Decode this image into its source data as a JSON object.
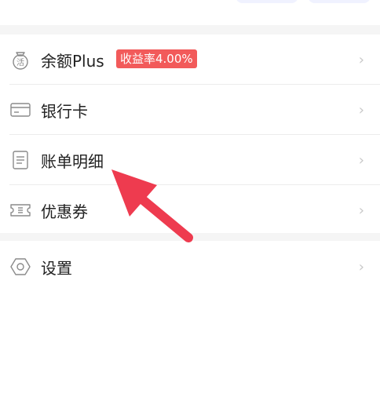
{
  "menu": {
    "items": [
      {
        "label": "余额Plus",
        "badge": "收益率4.00%",
        "icon": "huo-coin-icon"
      },
      {
        "label": "银行卡",
        "icon": "bank-card-icon"
      },
      {
        "label": "账单明细",
        "icon": "bill-icon"
      },
      {
        "label": "优惠券",
        "icon": "coupon-icon"
      }
    ],
    "settings": {
      "label": "设置",
      "icon": "settings-hex-icon"
    }
  },
  "annotation": {
    "arrow_color": "#ee3b4f"
  },
  "colors": {
    "badge": "#f25a5a",
    "icon_stroke": "#8a8a8a",
    "divider": "#ececec"
  }
}
